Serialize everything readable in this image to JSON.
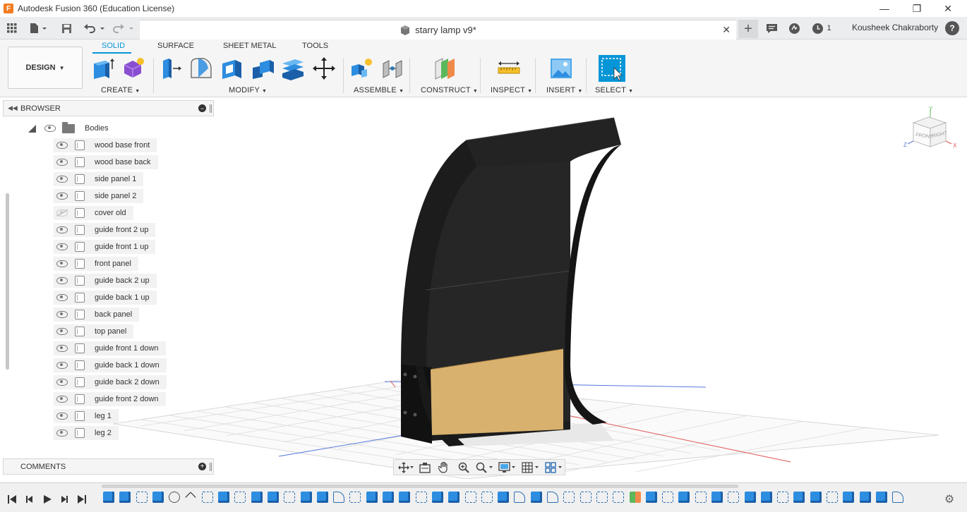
{
  "window": {
    "title": "Autodesk Fusion 360 (Education License)",
    "logo_letter": "F",
    "minimize": "—",
    "restore": "❐",
    "close": "✕"
  },
  "header": {
    "document_tab": "starry lamp v9*",
    "tab_close": "✕",
    "new_tab": "+",
    "job_count": "1",
    "user_name": "Kousheek Chakraborty",
    "help": "?"
  },
  "toolbar": {
    "workspace": "DESIGN",
    "tabs": [
      "SOLID",
      "SURFACE",
      "SHEET METAL",
      "TOOLS"
    ],
    "groups": {
      "create": "CREATE",
      "modify": "MODIFY",
      "assemble": "ASSEMBLE",
      "construct": "CONSTRUCT",
      "inspect": "INSPECT",
      "insert": "INSERT",
      "select": "SELECT"
    },
    "accent": "#0696d7"
  },
  "browser": {
    "title": "BROWSER",
    "folder": "Bodies",
    "bodies": [
      {
        "label": "wood base front",
        "visible": true
      },
      {
        "label": "wood base back",
        "visible": true
      },
      {
        "label": "side panel 1",
        "visible": true
      },
      {
        "label": "side panel 2",
        "visible": true
      },
      {
        "label": "cover old",
        "visible": false
      },
      {
        "label": "guide front 2 up",
        "visible": true
      },
      {
        "label": "guide front 1 up",
        "visible": true
      },
      {
        "label": "front panel",
        "visible": true
      },
      {
        "label": "guide back 2 up",
        "visible": true
      },
      {
        "label": "guide back 1 up",
        "visible": true
      },
      {
        "label": "back panel",
        "visible": true
      },
      {
        "label": "top panel",
        "visible": true
      },
      {
        "label": "guide front 1 down",
        "visible": true
      },
      {
        "label": "guide back 1 down",
        "visible": true
      },
      {
        "label": "guide back 2 down",
        "visible": true
      },
      {
        "label": "guide front 2 down",
        "visible": true
      },
      {
        "label": "leg 1",
        "visible": true
      },
      {
        "label": "leg 2",
        "visible": true
      }
    ]
  },
  "comments": {
    "title": "COMMENTS"
  },
  "viewcube": {
    "front": "FRONT",
    "right": "RIGHT",
    "x": "X",
    "y": "Y",
    "z": "Z"
  },
  "colors": {
    "body_black": "#1c1c1c",
    "wood": "#d9b16e",
    "x_axis": "#e05555",
    "z_axis": "#5577dd"
  }
}
